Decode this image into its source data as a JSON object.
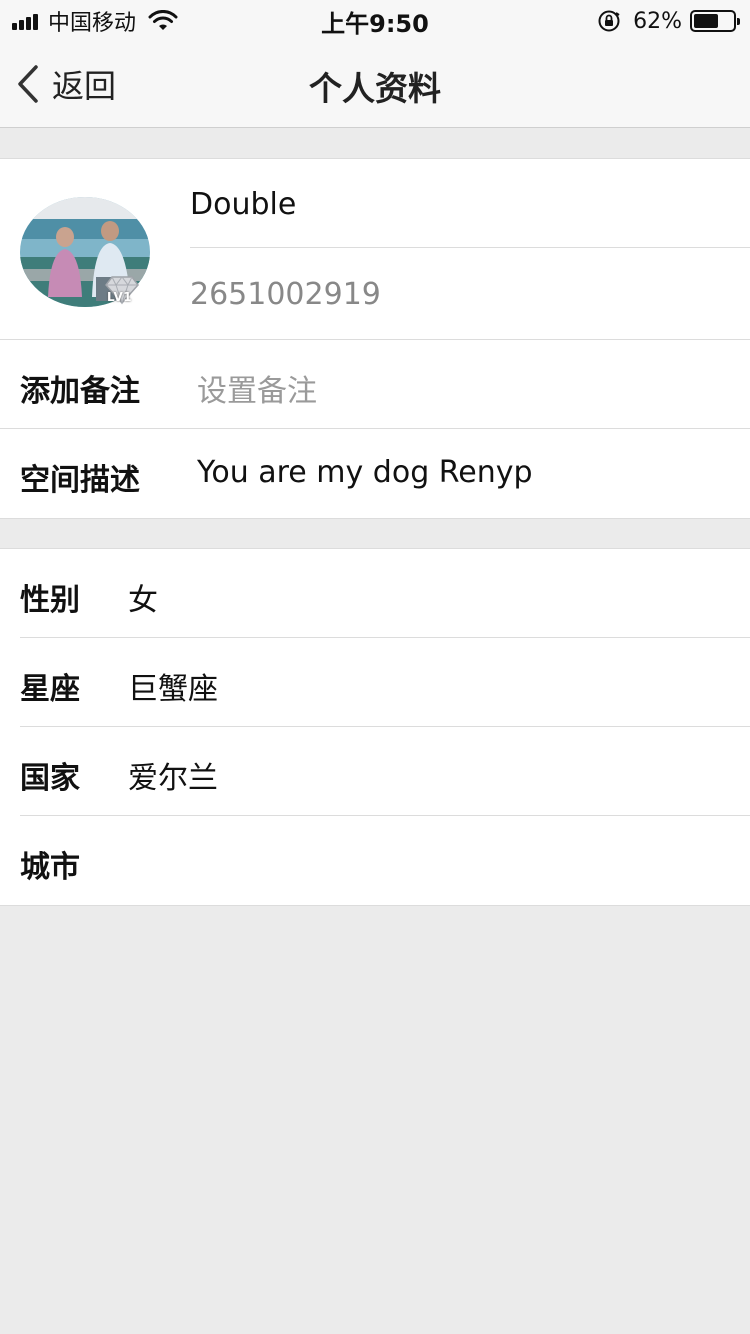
{
  "status_bar": {
    "carrier": "中国移动",
    "time": "上午9:50",
    "battery_percent_text": "62%",
    "battery_level": 0.62
  },
  "nav": {
    "back_label": "返回",
    "title": "个人资料"
  },
  "profile": {
    "name": "Double",
    "id": "2651002919",
    "level": "LV1"
  },
  "info_rows": [
    {
      "label": "添加备注",
      "value": "设置备注"
    },
    {
      "label": "空间描述",
      "value": "You are my dog Renyp"
    }
  ],
  "detail_rows": [
    {
      "label": "性别",
      "value": "女"
    },
    {
      "label": "星座",
      "value": "巨蟹座"
    },
    {
      "label": "国家",
      "value": "爱尔兰"
    },
    {
      "label": "城市",
      "value": ""
    }
  ],
  "colors": {
    "background": "#ebebeb",
    "placeholder": "#9a9a9a",
    "secondary_text": "#888888"
  }
}
